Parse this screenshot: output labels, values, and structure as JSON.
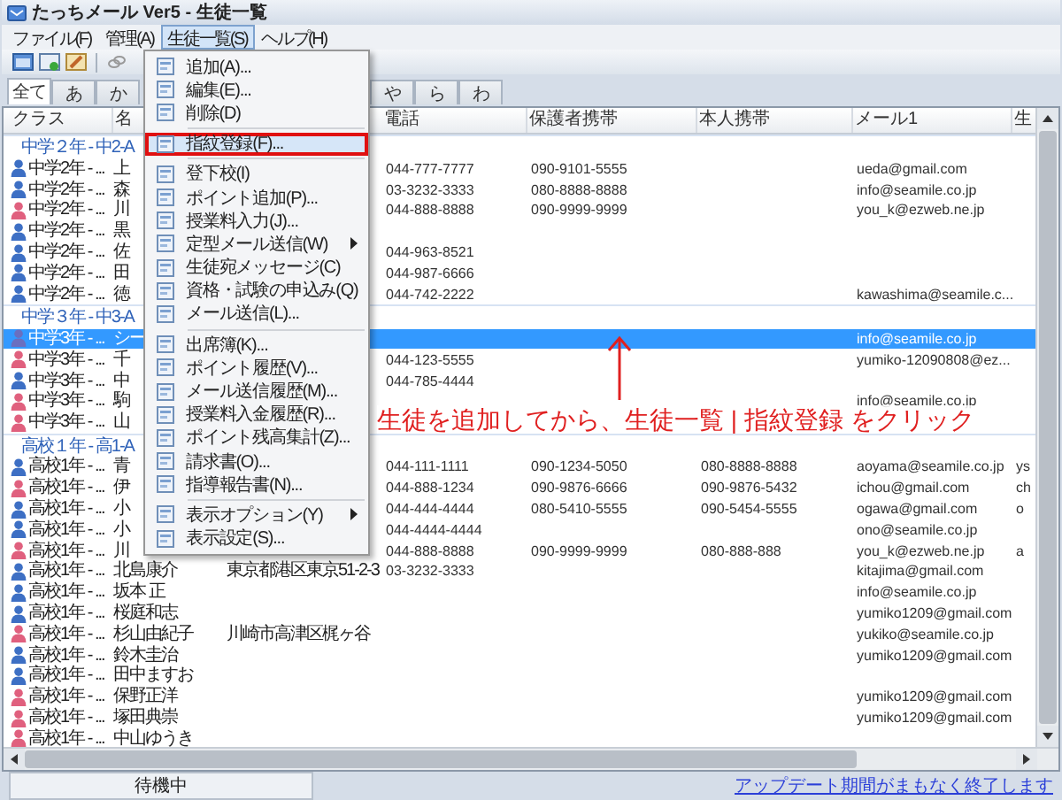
{
  "window": {
    "title": "たっちメール Ver5 - 生徒一覧"
  },
  "menu_bar": [
    {
      "label": "ファイル(F)",
      "selected": false
    },
    {
      "label": "管理(A)",
      "selected": false
    },
    {
      "label": "生徒一覧(S)",
      "selected": true
    },
    {
      "label": "ヘルプ(H)",
      "selected": false
    }
  ],
  "tabs": [
    {
      "label": "全て",
      "selected": true
    },
    {
      "label": "あ",
      "selected": false
    },
    {
      "label": "か",
      "selected": false
    },
    {
      "label": "や",
      "selected": false
    },
    {
      "label": "ら",
      "selected": false
    },
    {
      "label": "わ",
      "selected": false
    }
  ],
  "table": {
    "columns": [
      "クラス",
      "名",
      "電話",
      "保護者携帯",
      "本人携帯",
      "メール1",
      "生"
    ],
    "rows": [
      {
        "kind": "group",
        "label": "中学２年 - 中2-A"
      },
      {
        "kind": "student",
        "selected": false,
        "color": "#3d6fc4",
        "class": "中学2年 - ...",
        "name": "上",
        "phone": "044-777-7777",
        "guardian_mobile": "090-9101-5555",
        "mail_1": "ueda@gmail.com"
      },
      {
        "kind": "student",
        "selected": false,
        "color": "#3d6fc4",
        "class": "中学2年 - ...",
        "name": "森",
        "phone": "03-3232-3333",
        "guardian_mobile": "080-8888-8888",
        "mail_1": "info@seamile.co.jp"
      },
      {
        "kind": "student",
        "selected": false,
        "color": "#e0607e",
        "class": "中学2年 - ...",
        "name": "川",
        "phone": "044-888-8888",
        "guardian_mobile": "090-9999-9999",
        "mail_1": "you_k@ezweb.ne.jp"
      },
      {
        "kind": "student",
        "selected": false,
        "color": "#3d6fc4",
        "class": "中学2年 - ...",
        "name": "黒"
      },
      {
        "kind": "student",
        "selected": false,
        "color": "#3d6fc4",
        "class": "中学2年 - ...",
        "name": "佐",
        "phone": "044-963-8521"
      },
      {
        "kind": "student",
        "selected": false,
        "color": "#3d6fc4",
        "class": "中学2年 - ...",
        "name": "田",
        "phone": "044-987-6666"
      },
      {
        "kind": "student",
        "selected": false,
        "color": "#3d6fc4",
        "class": "中学2年 - ...",
        "name": "徳",
        "phone": "044-742-2222",
        "mail_1": "kawashima@seamile.c..."
      },
      {
        "kind": "group",
        "label": "中学３年 - 中3-A"
      },
      {
        "kind": "student",
        "selected": true,
        "color": "#6a6fc0",
        "class": "中学3年 - ...",
        "name": "シー",
        "mail_1": "info@seamile.co.jp"
      },
      {
        "kind": "student",
        "selected": false,
        "color": "#e0607e",
        "class": "中学3年 - ...",
        "name": "千",
        "phone": "044-123-5555",
        "mail_1": "yumiko-12090808@ez..."
      },
      {
        "kind": "student",
        "selected": false,
        "color": "#3d6fc4",
        "class": "中学3年 - ...",
        "name": "中",
        "phone": "044-785-4444"
      },
      {
        "kind": "student",
        "selected": false,
        "color": "#e0607e",
        "class": "中学3年 - ...",
        "name": "駒",
        "mail_1": "info@seamile.co.jp"
      },
      {
        "kind": "student",
        "selected": false,
        "color": "#e0607e",
        "class": "中学3年 - ...",
        "name": "山"
      },
      {
        "kind": "group",
        "label": "高校１年 - 高1-A"
      },
      {
        "kind": "student",
        "selected": false,
        "color": "#3d6fc4",
        "class": "高校1年 - ...",
        "name": "青",
        "phone": "044-111-1111",
        "guardian_mobile": "090-1234-5050",
        "own_mobile": "080-8888-8888",
        "mail_1": "aoyama@seamile.co.jp",
        "column_8": "ys"
      },
      {
        "kind": "student",
        "selected": false,
        "color": "#e0607e",
        "class": "高校1年 - ...",
        "name": "伊",
        "phone": "044-888-1234",
        "guardian_mobile": "090-9876-6666",
        "own_mobile": "090-9876-5432",
        "mail_1": "ichou@gmail.com",
        "column_8": "ch"
      },
      {
        "kind": "student",
        "selected": false,
        "color": "#3d6fc4",
        "class": "高校1年 - ...",
        "name": "小",
        "phone": "044-444-4444",
        "guardian_mobile": "080-5410-5555",
        "own_mobile": "090-5454-5555",
        "mail_1": "ogawa@gmail.com",
        "column_8": "o"
      },
      {
        "kind": "student",
        "selected": false,
        "color": "#3d6fc4",
        "class": "高校1年 - ...",
        "name": "小",
        "phone": "044-4444-4444",
        "mail_1": "ono@seamile.co.jp"
      },
      {
        "kind": "student",
        "selected": false,
        "color": "#e0607e",
        "class": "高校1年 - ...",
        "name": "川",
        "phone": "044-888-8888",
        "guardian_mobile": "090-9999-9999",
        "own_mobile": "080-888-888",
        "mail_1": "you_k@ezweb.ne.jp",
        "column_8": "a"
      },
      {
        "kind": "student",
        "selected": false,
        "color": "#3d6fc4",
        "class": "高校1年 - ...",
        "name": "北島康介",
        "column_3": "東京都港区東京51-2-3",
        "phone": "03-3232-3333",
        "mail_1": "kitajima@gmail.com"
      },
      {
        "kind": "student",
        "selected": false,
        "color": "#3d6fc4",
        "class": "高校1年 - ...",
        "name": "坂本 正",
        "mail_1": "info@seamile.co.jp"
      },
      {
        "kind": "student",
        "selected": false,
        "color": "#3d6fc4",
        "class": "高校1年 - ...",
        "name": "桜庭和志",
        "mail_1": "yumiko1209@gmail.com"
      },
      {
        "kind": "student",
        "selected": false,
        "color": "#e0607e",
        "class": "高校1年 - ...",
        "name": "杉山由紀子",
        "column_3": "川崎市高津区梶ヶ谷",
        "mail_1": "yukiko@seamile.co.jp"
      },
      {
        "kind": "student",
        "selected": false,
        "color": "#3d6fc4",
        "class": "高校1年 - ...",
        "name": "鈴木圭治",
        "mail_1": "yumiko1209@gmail.com"
      },
      {
        "kind": "student",
        "selected": false,
        "color": "#3d6fc4",
        "class": "高校1年 - ...",
        "name": "田中ますお"
      },
      {
        "kind": "student",
        "selected": false,
        "color": "#e0607e",
        "class": "高校1年 - ...",
        "name": "保野正洋",
        "mail_1": "yumiko1209@gmail.com"
      },
      {
        "kind": "student",
        "selected": false,
        "color": "#e0607e",
        "class": "高校1年 - ...",
        "name": "塚田典崇",
        "mail_1": "yumiko1209@gmail.com"
      },
      {
        "kind": "student",
        "selected": false,
        "color": "#e0607e",
        "class": "高校1年 - ...",
        "name": "中山ゆうき"
      }
    ]
  },
  "menu": {
    "items": [
      {
        "kind": "item",
        "label": "追加(A)...",
        "selected": false,
        "outlined": false,
        "submenu": false
      },
      {
        "kind": "item",
        "label": "編集(E)...",
        "selected": false,
        "outlined": false,
        "submenu": false
      },
      {
        "kind": "item",
        "label": "削除(D)",
        "selected": false,
        "outlined": false,
        "submenu": false
      },
      {
        "kind": "separator"
      },
      {
        "kind": "item",
        "label": "指紋登録(F)...",
        "selected": true,
        "outlined": true,
        "submenu": false
      },
      {
        "kind": "separator"
      },
      {
        "kind": "item",
        "label": "登下校(I)",
        "selected": false,
        "outlined": false,
        "submenu": false
      },
      {
        "kind": "item",
        "label": "ポイント追加(P)...",
        "selected": false,
        "outlined": false,
        "submenu": false
      },
      {
        "kind": "item",
        "label": "授業料入力(J)...",
        "selected": false,
        "outlined": false,
        "submenu": false
      },
      {
        "kind": "item",
        "label": "定型メール送信(W)",
        "selected": false,
        "outlined": false,
        "submenu": true
      },
      {
        "kind": "item",
        "label": "生徒宛メッセージ(C)",
        "selected": false,
        "outlined": false,
        "submenu": false
      },
      {
        "kind": "item",
        "label": "資格・試験の申込み(Q)",
        "selected": false,
        "outlined": false,
        "submenu": false
      },
      {
        "kind": "item",
        "label": "メール送信(L)...",
        "selected": false,
        "outlined": false,
        "submenu": false
      },
      {
        "kind": "separator"
      },
      {
        "kind": "item",
        "label": "出席簿(K)...",
        "selected": false,
        "outlined": false,
        "submenu": false
      },
      {
        "kind": "item",
        "label": "ポイント履歴(V)...",
        "selected": false,
        "outlined": false,
        "submenu": false
      },
      {
        "kind": "item",
        "label": "メール送信履歴(M)...",
        "selected": false,
        "outlined": false,
        "submenu": false
      },
      {
        "kind": "item",
        "label": "授業料入金履歴(R)...",
        "selected": false,
        "outlined": false,
        "submenu": false
      },
      {
        "kind": "item",
        "label": "ポイント残高集計(Z)...",
        "selected": false,
        "outlined": false,
        "submenu": false
      },
      {
        "kind": "item",
        "label": "請求書(O)...",
        "selected": false,
        "outlined": false,
        "submenu": false
      },
      {
        "kind": "item",
        "label": "指導報告書(N)...",
        "selected": false,
        "outlined": false,
        "submenu": false
      },
      {
        "kind": "separator"
      },
      {
        "kind": "item",
        "label": "表示オプション(Y)",
        "selected": false,
        "outlined": false,
        "submenu": true
      },
      {
        "kind": "item",
        "label": "表示設定(S)...",
        "selected": false,
        "outlined": false,
        "submenu": false
      }
    ]
  },
  "annotation": {
    "text": "生徒を追加してから、生徒一覧 | 指紋登録 をクリック"
  },
  "status_bar": {
    "status": "待機中",
    "link": "アップデート期間がまもなく終了します"
  }
}
